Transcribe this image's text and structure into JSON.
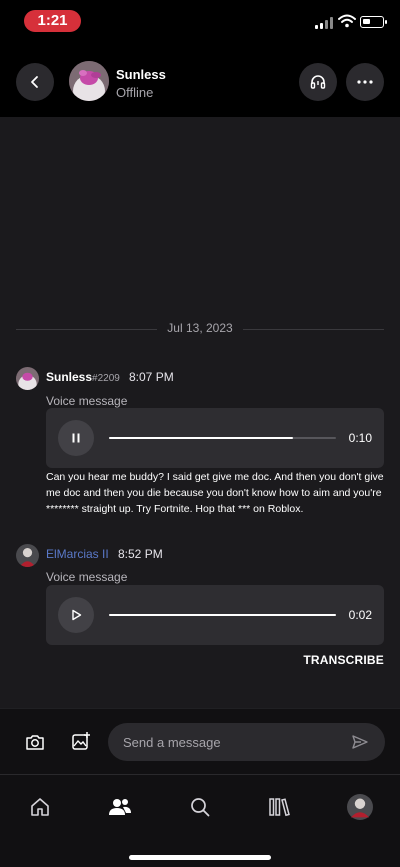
{
  "status_bar": {
    "time": "1:21"
  },
  "header": {
    "contact_name": "Sunless",
    "contact_status": "Offline",
    "icons": {
      "back": "chevron-left-icon",
      "call": "headset-icon",
      "more": "ellipsis-icon"
    }
  },
  "chat": {
    "date_divider": "Jul 13, 2023",
    "messages": [
      {
        "author": "Sunless",
        "discriminator": "#2209",
        "time": "8:07 PM",
        "voice_label": "Voice message",
        "duration": "0:10",
        "progress": 0.81,
        "playing": true,
        "text": "Can you hear me buddy? I said get give me doc. And then you don't give me doc and then you die because you don't know how to aim and you're ******** straight up. Try Fortnite. Hop that *** on Roblox."
      },
      {
        "author": "ElMarcias II",
        "time": "8:52 PM",
        "voice_label": "Voice message",
        "duration": "0:02",
        "progress": 1.0,
        "playing": false,
        "author_color": "#5a79c9"
      }
    ],
    "transcribe_label": "TRANSCRIBE"
  },
  "input_bar": {
    "placeholder": "Send a message",
    "icons": {
      "camera": "camera-icon",
      "gallery": "image-icon",
      "send": "send-icon"
    }
  },
  "bottom_nav": {
    "items": [
      {
        "icon": "home-icon",
        "active": false
      },
      {
        "icon": "friends-icon",
        "active": true
      },
      {
        "icon": "search-icon",
        "active": false
      },
      {
        "icon": "library-icon",
        "active": false
      },
      {
        "icon": "profile-avatar",
        "active": false
      }
    ]
  },
  "colors": {
    "accent_status": "#d6303a",
    "link_blue": "#5a79c9",
    "background": "#1b1a1d"
  }
}
